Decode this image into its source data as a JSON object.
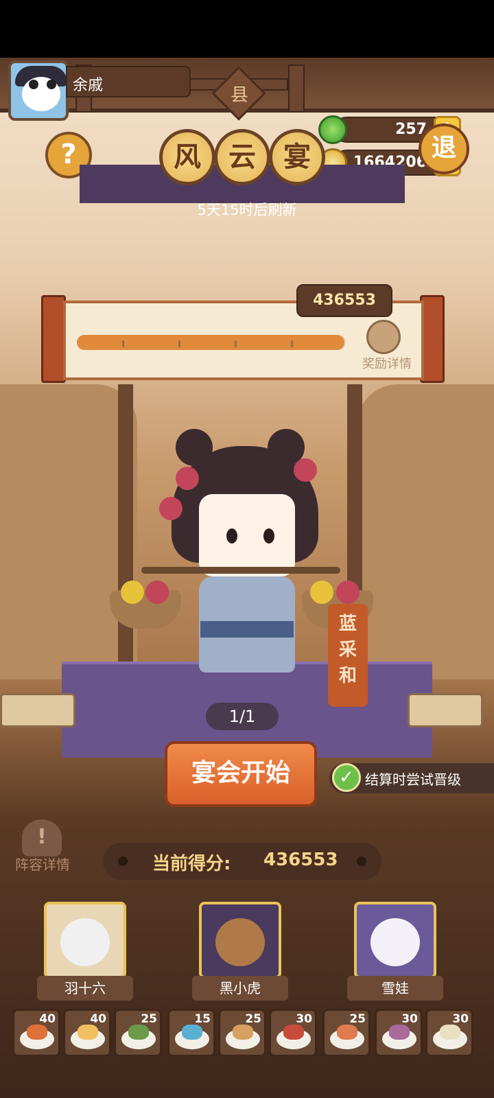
{
  "player": {
    "name": "余戚"
  },
  "resources": {
    "green_currency": "257",
    "coins": "1664206"
  },
  "badge": {
    "county": "县"
  },
  "buttons": {
    "help": "?",
    "exit": "退"
  },
  "event": {
    "title_chars": [
      "风",
      "云",
      "宴"
    ],
    "refresh_text": "5天15时后刷新",
    "target_score": "436553",
    "reward_details_label": "奖励详情",
    "progress": 0.995
  },
  "character": {
    "name_tag": "蓝\n采\n和",
    "page_indicator": "1/1"
  },
  "actions": {
    "start_label": "宴会开始",
    "promote_toggle_label": "结算时尝试晋级",
    "promote_checked": true,
    "lineup_label": "阵容详情",
    "lineup_icon": "!"
  },
  "score": {
    "label": "当前得分:",
    "value": "436553"
  },
  "heroes": [
    {
      "name": "羽十六"
    },
    {
      "name": "黑小虎"
    },
    {
      "name": "雪娃"
    }
  ],
  "dishes": [
    {
      "count": "40"
    },
    {
      "count": "40"
    },
    {
      "count": "25"
    },
    {
      "count": "15"
    },
    {
      "count": "25"
    },
    {
      "count": "30"
    },
    {
      "count": "25"
    },
    {
      "count": "30"
    },
    {
      "count": "30"
    }
  ],
  "colors": {
    "accent": "#e08a3c",
    "coin_gold": "#f5c83c",
    "check_green": "#6cc04a",
    "tag_red": "#c25a2a"
  }
}
